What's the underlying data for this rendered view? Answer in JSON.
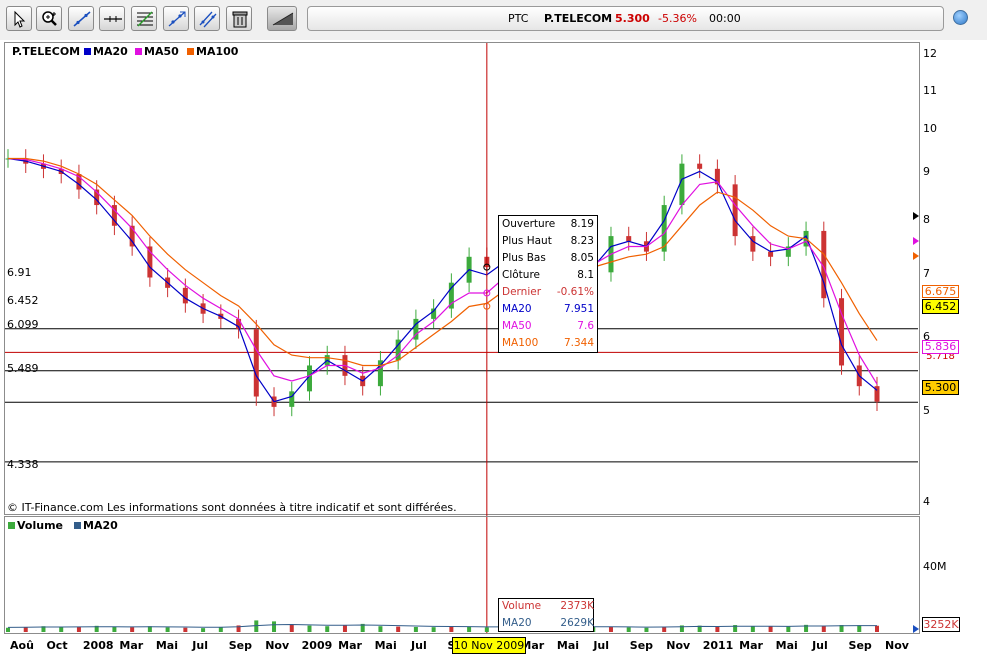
{
  "toolbar": {
    "tools": [
      {
        "name": "pointer-tool",
        "icon": "arrow-cursor-icon"
      },
      {
        "name": "zoom-tool",
        "icon": "magnifier-plus-icon"
      },
      {
        "name": "trendline-tool",
        "icon": "trendline-icon"
      },
      {
        "name": "horizontal-line-tool",
        "icon": "horizontal-line-icon"
      },
      {
        "name": "fibonacci-tool",
        "icon": "fibonacci-icon"
      },
      {
        "name": "channel-tool",
        "icon": "channel-icon"
      },
      {
        "name": "parallel-lines-tool",
        "icon": "parallel-lines-icon"
      },
      {
        "name": "delete-tool",
        "icon": "trash-icon"
      }
    ],
    "collapse_icon": "collapse-arrow-icon",
    "info_icon": "info-icon"
  },
  "quote": {
    "code": "PTC",
    "name": "P.TELECOM",
    "price": "5.300",
    "change": "-5.36%",
    "time": "00:00"
  },
  "colors": {
    "ma20": "#0000c8",
    "ma50": "#e010e0",
    "ma100": "#f06000",
    "candle_up": "#3caa3c",
    "candle_down": "#cc3333",
    "cursor_line": "#c00000",
    "volume": "#3caa3c",
    "negative": "#cc0000"
  },
  "price_panel": {
    "legend": [
      "P.TELECOM",
      "MA20",
      "MA50",
      "MA100"
    ],
    "y_axis_ticks": [
      "12",
      "11",
      "10",
      "9",
      "8",
      "7",
      "6",
      "5",
      "4"
    ],
    "horizontal_levels": [
      "6.91",
      "6.452",
      "6.099",
      "5.489",
      "4.338"
    ],
    "last_values": {
      "ma100": "6.675",
      "last_price": "6.452",
      "ma50": "5.836",
      "ma20_partial": "5.718",
      "current": "5.300"
    },
    "copyright": "© IT-Finance.com Les informations sont données à titre indicatif et sont différées."
  },
  "tooltip": {
    "rows": [
      {
        "label": "Ouverture",
        "value": "8.19"
      },
      {
        "label": "Plus Haut",
        "value": "8.23"
      },
      {
        "label": "Plus Bas",
        "value": "8.05"
      },
      {
        "label": "Clôture",
        "value": "8.1"
      },
      {
        "label": "Dernier",
        "value": "-0.61%"
      },
      {
        "label": "MA20",
        "value": "7.951"
      },
      {
        "label": "MA50",
        "value": "7.6"
      },
      {
        "label": "MA100",
        "value": "7.344"
      }
    ]
  },
  "volume_panel": {
    "legend": [
      "Volume",
      "MA20"
    ],
    "y_axis_tick": "40M",
    "last_value": "3252K",
    "tooltip": [
      {
        "label": "Volume",
        "value": "2373K"
      },
      {
        "label": "MA20",
        "value": "2629K"
      }
    ]
  },
  "x_axis": {
    "months": [
      "Aoû",
      "Oct",
      "2008",
      "Mar",
      "Mai",
      "Jul",
      "Sep",
      "Nov",
      "2009",
      "Mar",
      "Mai",
      "Jul",
      "Sep",
      "2010",
      "Mar",
      "Mai",
      "Jul",
      "Sep",
      "Nov",
      "2011",
      "Mar",
      "Mai",
      "Jul",
      "Sep",
      "Nov"
    ],
    "cursor_date": "10 Nov 2009"
  },
  "chart_data": {
    "type": "line",
    "title": "P.TELECOM",
    "price_ylim": [
      3.6,
      12.2
    ],
    "x": [
      "2007-08",
      "2007-09",
      "2007-10",
      "2007-11",
      "2007-12",
      "2008-01",
      "2008-02",
      "2008-03",
      "2008-04",
      "2008-05",
      "2008-06",
      "2008-07",
      "2008-08",
      "2008-09",
      "2008-10",
      "2008-11",
      "2008-12",
      "2009-01",
      "2009-02",
      "2009-03",
      "2009-04",
      "2009-05",
      "2009-06",
      "2009-07",
      "2009-08",
      "2009-09",
      "2009-10",
      "2009-11",
      "2009-12",
      "2010-01",
      "2010-02",
      "2010-03",
      "2010-04",
      "2010-05",
      "2010-06",
      "2010-07",
      "2010-08",
      "2010-09",
      "2010-10",
      "2010-11",
      "2010-12",
      "2011-01",
      "2011-02",
      "2011-03",
      "2011-04",
      "2011-05",
      "2011-06",
      "2011-07",
      "2011-08",
      "2011-09"
    ],
    "series": [
      {
        "name": "P.TELECOM",
        "values": [
          10.2,
          10.1,
          10.0,
          9.9,
          9.6,
          9.3,
          8.9,
          8.5,
          7.9,
          7.7,
          7.4,
          7.2,
          7.1,
          6.9,
          5.6,
          5.4,
          5.7,
          6.2,
          6.4,
          6.0,
          5.8,
          6.3,
          6.7,
          7.1,
          7.3,
          7.8,
          8.3,
          8.1,
          8.3,
          8.6,
          8.2,
          8.1,
          8.4,
          8.0,
          8.7,
          8.6,
          8.4,
          9.3,
          10.1,
          10.0,
          9.7,
          8.7,
          8.4,
          8.3,
          8.5,
          8.8,
          7.5,
          6.2,
          5.8,
          5.5
        ]
      },
      {
        "name": "MA20",
        "values": [
          10.2,
          10.15,
          10.05,
          9.95,
          9.7,
          9.4,
          9.0,
          8.6,
          8.1,
          7.8,
          7.5,
          7.3,
          7.15,
          6.95,
          6.0,
          5.5,
          5.6,
          6.0,
          6.3,
          6.1,
          5.9,
          6.2,
          6.6,
          7.0,
          7.25,
          7.7,
          8.05,
          7.95,
          8.2,
          8.4,
          8.25,
          8.15,
          8.3,
          8.1,
          8.5,
          8.6,
          8.5,
          9.0,
          9.8,
          9.95,
          9.75,
          9.0,
          8.6,
          8.4,
          8.45,
          8.7,
          7.8,
          6.6,
          6.0,
          5.72
        ]
      },
      {
        "name": "MA50",
        "values": [
          10.2,
          10.18,
          10.1,
          10.0,
          9.85,
          9.55,
          9.2,
          8.85,
          8.4,
          8.05,
          7.75,
          7.5,
          7.3,
          7.1,
          6.5,
          6.0,
          5.9,
          6.0,
          6.2,
          6.2,
          6.05,
          6.15,
          6.4,
          6.8,
          7.05,
          7.4,
          7.6,
          7.6,
          7.9,
          8.15,
          8.2,
          8.15,
          8.25,
          8.15,
          8.35,
          8.5,
          8.5,
          8.75,
          9.3,
          9.7,
          9.75,
          9.3,
          8.9,
          8.55,
          8.45,
          8.6,
          8.1,
          7.2,
          6.4,
          5.84
        ]
      },
      {
        "name": "MA100",
        "values": [
          10.2,
          10.2,
          10.15,
          10.05,
          9.9,
          9.7,
          9.4,
          9.1,
          8.7,
          8.35,
          8.05,
          7.8,
          7.55,
          7.35,
          7.0,
          6.6,
          6.4,
          6.35,
          6.35,
          6.3,
          6.2,
          6.2,
          6.3,
          6.55,
          6.8,
          7.05,
          7.34,
          7.4,
          7.65,
          7.9,
          8.0,
          8.05,
          8.15,
          8.1,
          8.2,
          8.3,
          8.35,
          8.5,
          8.9,
          9.3,
          9.55,
          9.45,
          9.2,
          8.9,
          8.7,
          8.65,
          8.35,
          7.8,
          7.2,
          6.68
        ]
      }
    ],
    "volume": {
      "unit": "K",
      "ylim": [
        0,
        58000
      ],
      "values": [
        2200,
        2500,
        3000,
        2400,
        2800,
        3200,
        2600,
        2500,
        3000,
        2400,
        2200,
        2000,
        2600,
        3400,
        6000,
        5500,
        3800,
        3300,
        3000,
        3600,
        4200,
        3000,
        2800,
        2600,
        2500,
        3000,
        2800,
        2373,
        2600,
        3000,
        2700,
        2500,
        3200,
        2600,
        2800,
        2400,
        2200,
        2800,
        3400,
        3300,
        2600,
        3600,
        2900,
        3000,
        2800,
        3700,
        3200,
        3600,
        3500,
        3252
      ],
      "ma20": [
        2400,
        2500,
        2600,
        2600,
        2650,
        2700,
        2700,
        2650,
        2700,
        2650,
        2600,
        2500,
        2500,
        2700,
        3300,
        3800,
        3900,
        3700,
        3500,
        3500,
        3600,
        3450,
        3300,
        3100,
        2900,
        2850,
        2800,
        2629,
        2650,
        2700,
        2700,
        2650,
        2750,
        2700,
        2700,
        2650,
        2550,
        2600,
        2750,
        2900,
        2850,
        3000,
        2950,
        2950,
        2900,
        3100,
        3100,
        3250,
        3300,
        3300
      ]
    }
  }
}
